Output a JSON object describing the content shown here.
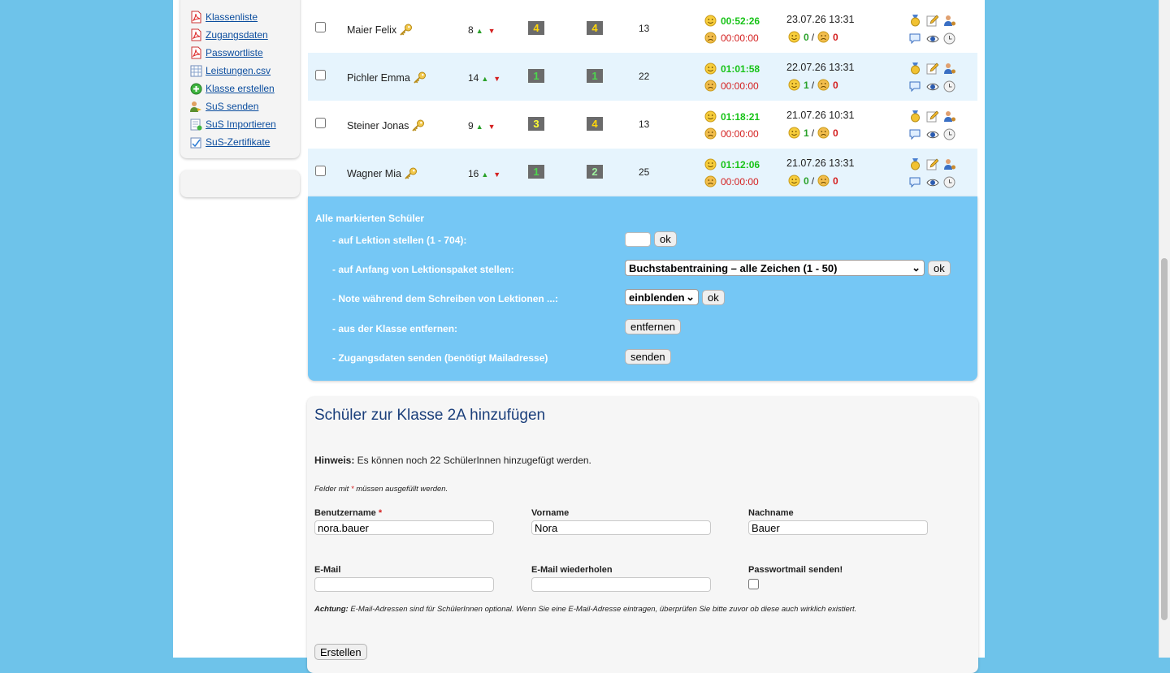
{
  "sidebar": {
    "links": [
      {
        "label": "Klassenliste",
        "icon": "pdf-icon"
      },
      {
        "label": "Zugangsdaten",
        "icon": "pdf-icon"
      },
      {
        "label": "Passwortliste",
        "icon": "pdf-icon"
      },
      {
        "label": "Leistungen.csv",
        "icon": "spreadsheet-icon"
      },
      {
        "label": "Klasse erstellen",
        "icon": "add-circle-icon"
      },
      {
        "label": "SuS senden",
        "icon": "users-send-icon"
      },
      {
        "label": "SuS Importieren",
        "icon": "import-icon"
      },
      {
        "label": "SuS-Zertifikate",
        "icon": "certificate-icon"
      }
    ]
  },
  "students": [
    {
      "name": "Maier Felix",
      "lesson": "8",
      "grade1": "4",
      "grade2": "4",
      "grade1_color": "#ffd60a",
      "grade2_color": "#ffd60a",
      "count": "13",
      "time_good": "00:52:26",
      "time_bad": "00:00:00",
      "date": "23.07.26 13:31",
      "score_good": "0",
      "score_sep": "/",
      "score_bad": "0"
    },
    {
      "name": "Pichler Emma",
      "lesson": "14",
      "grade1": "1",
      "grade2": "1",
      "grade1_color": "#4dd84d",
      "grade2_color": "#4dd84d",
      "count": "22",
      "time_good": "01:01:58",
      "time_bad": "00:00:00",
      "date": "22.07.26 13:31",
      "score_good": "1",
      "score_sep": "/",
      "score_bad": "0"
    },
    {
      "name": "Steiner Jonas",
      "lesson": "9",
      "grade1": "3",
      "grade2": "4",
      "grade1_color": "#ffff33",
      "grade2_color": "#ffd60a",
      "count": "13",
      "time_good": "01:18:21",
      "time_bad": "00:00:00",
      "date": "21.07.26 10:31",
      "score_good": "1",
      "score_sep": "/",
      "score_bad": "0"
    },
    {
      "name": "Wagner Mia",
      "lesson": "16",
      "grade1": "1",
      "grade2": "2",
      "grade1_color": "#4dd84d",
      "grade2_color": "#9ef09e",
      "count": "25",
      "time_good": "01:12:06",
      "time_bad": "00:00:00",
      "date": "21.07.26 13:31",
      "score_good": "0",
      "score_sep": "/",
      "score_bad": "0"
    }
  ],
  "bulk": {
    "title": "Alle markierten Schüler",
    "rows": [
      "- auf Lektion stellen (1 - 704):",
      "- auf Anfang von Lektionspaket stellen:",
      "- Note während dem Schreiben von Lektionen ...:",
      "- aus der Klasse entfernen:",
      "- Zugangsdaten senden (benötigt Mailadresse)"
    ],
    "ok_label": "ok",
    "package_selected": "Buchstabentraining – alle Zeichen (1 - 50)",
    "grade_display_selected": "einblenden",
    "remove_label": "entfernen",
    "send_label": "senden"
  },
  "add_student": {
    "title": "Schüler zur Klasse 2A hinzufügen",
    "hint_label": "Hinweis:",
    "hint_text": " Es können noch 22 SchülerInnen hinzugefügt werden.",
    "required_note_prefix": "Felder mit ",
    "required_star": "*",
    "required_note_suffix": " müssen ausgefüllt werden.",
    "username_label": "Benutzername",
    "username_value": "nora.bauer",
    "firstname_label": "Vorname",
    "firstname_value": "Nora",
    "lastname_label": "Nachname",
    "lastname_value": "Bauer",
    "email_label": "E-Mail",
    "email_repeat_label": "E-Mail wiederholen",
    "passwordmail_label": "Passwortmail senden!",
    "warn_label": "Achtung:",
    "warn_text": " E-Mail-Adressen sind für SchülerInnen optional. Wenn Sie eine E-Mail-Adresse eintragen, überprüfen Sie bitte zuvor ob diese auch wirklich existiert.",
    "create_label": "Erstellen"
  }
}
